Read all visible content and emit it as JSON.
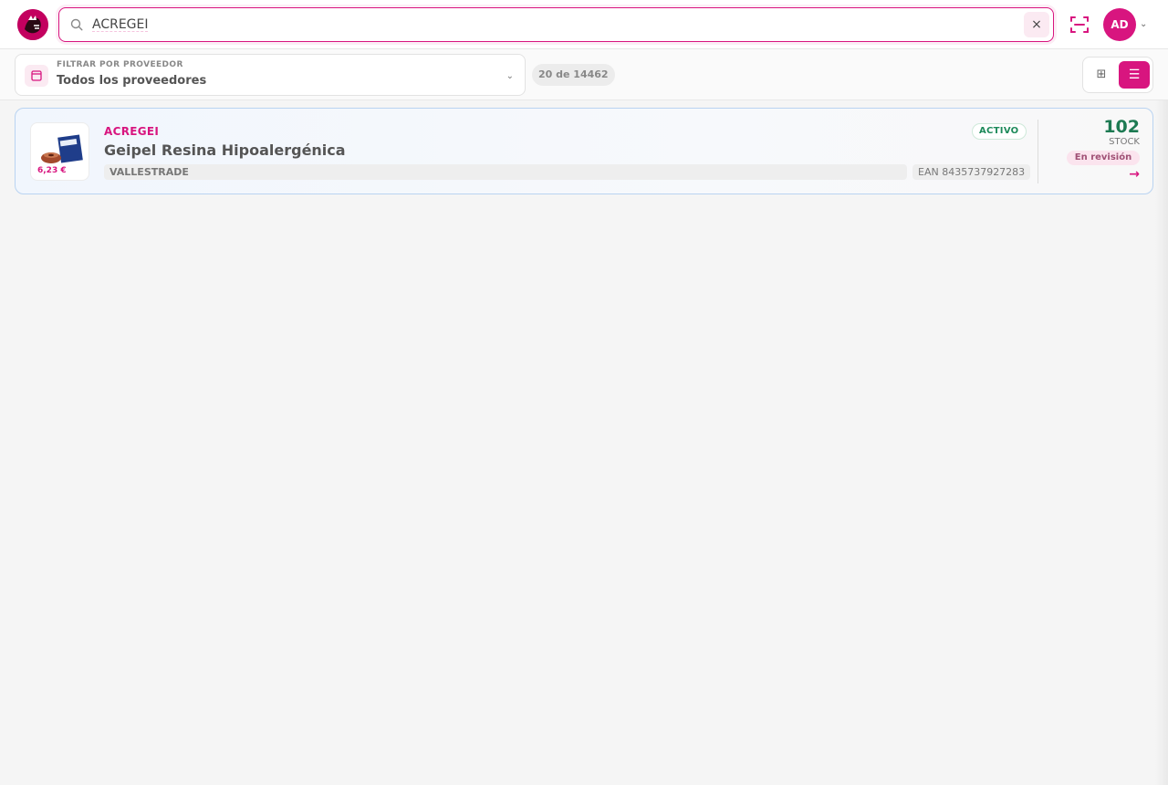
{
  "header": {
    "search": {
      "value": "ACREGEI",
      "placeholder": ""
    },
    "clear_label": "×",
    "avatar_initials": "AD",
    "avatar_chevron": "⌄"
  },
  "filters": {
    "provider_label": "FILTRAR POR PROVEEDOR",
    "provider_value": "Todos los proveedores",
    "provider_chevron": "⌄",
    "result_count": "20 de 14462",
    "grid_view_icon": "⊞",
    "list_view_icon": "☰"
  },
  "products": [
    {
      "price": "6,23 €",
      "code": "ACREGEI",
      "name": "Geipel Resina Hipoalergénica",
      "status": "ACTIVO",
      "supplier": "VALLESTRADE",
      "ean": "EAN 8435737927283",
      "stock": "102",
      "stock_label": "STOCK",
      "review": "En revisión",
      "arrow": "→"
    }
  ],
  "colors": {
    "accent": "#d8157f",
    "stock_green": "#1d7a52",
    "card_border": "#b9d3f1"
  },
  "icons": {
    "logo": "brand-logo",
    "search": "search-icon",
    "clear": "close-icon",
    "scan": "barcode-scan-icon",
    "provider": "store-icon",
    "grid": "grid-icon",
    "list": "list-icon",
    "arrow": "arrow-right-icon"
  }
}
